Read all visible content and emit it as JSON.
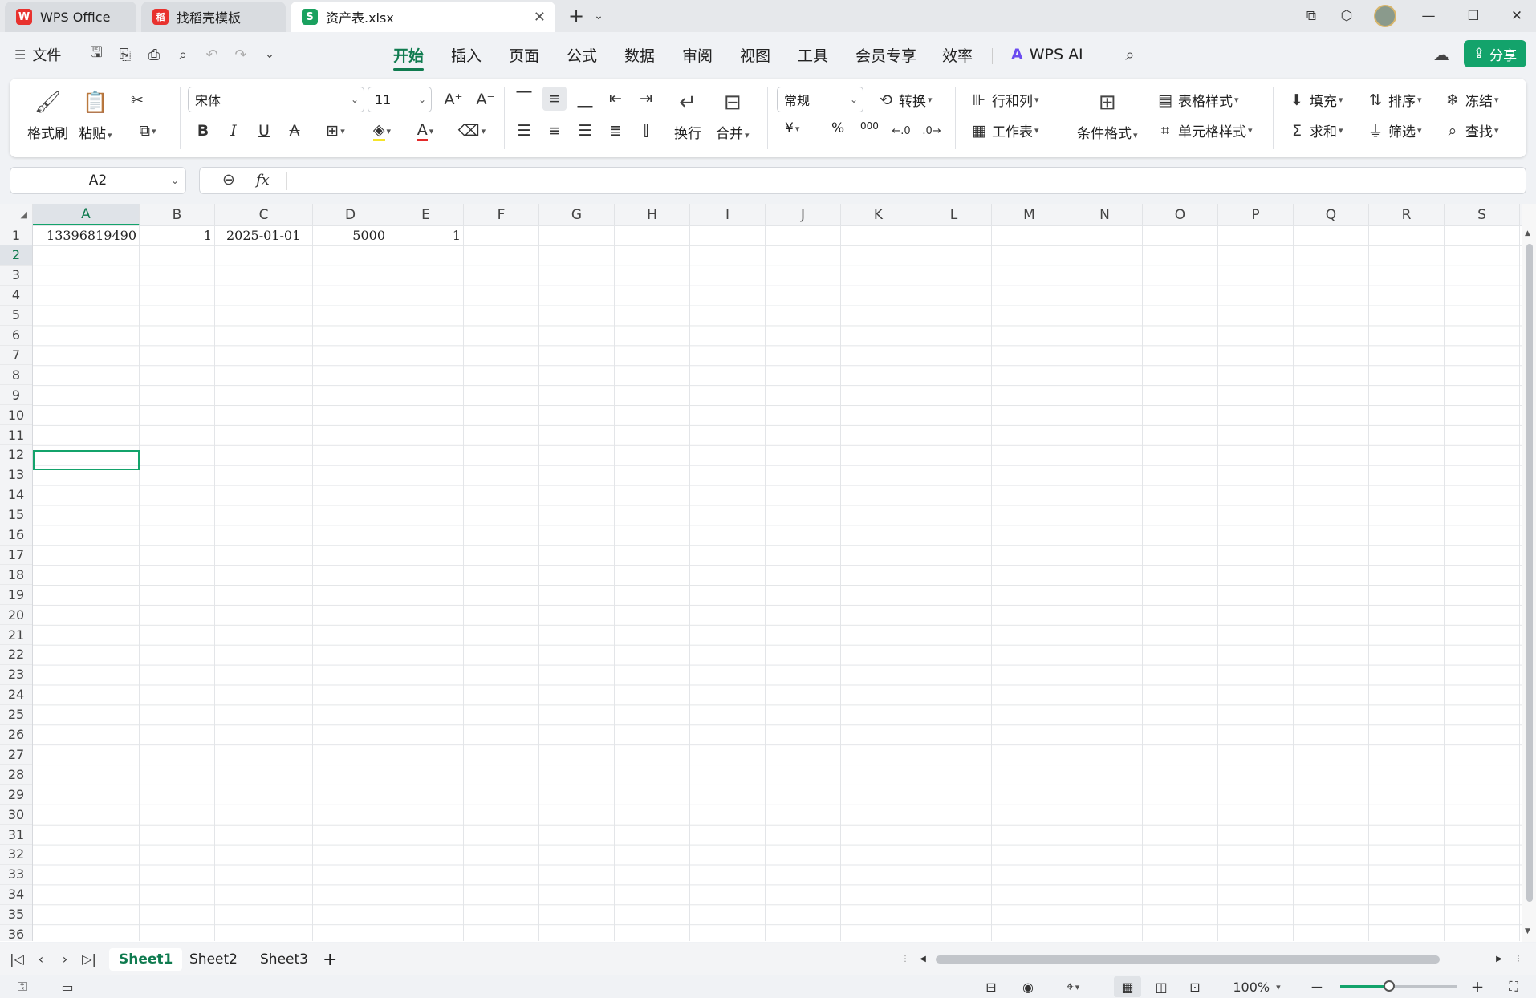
{
  "titlebar": {
    "tabs": [
      {
        "label": "WPS Office",
        "logo": "W"
      },
      {
        "label": "找稻壳模板",
        "logo": "稻"
      },
      {
        "label": "资产表.xlsx",
        "logo": "S"
      }
    ],
    "new_tab": "+",
    "tab_menu": "⌄"
  },
  "menu": {
    "file_label": "文件",
    "tabs": [
      "开始",
      "插入",
      "页面",
      "公式",
      "数据",
      "审阅",
      "视图",
      "工具",
      "会员专享",
      "效率"
    ],
    "active_tab": "开始",
    "ai_label": "WPS AI",
    "share_label": "分享"
  },
  "ribbon": {
    "format_painter": "格式刷",
    "paste": "粘贴",
    "font_name": "宋体",
    "font_size": "11",
    "wrap": "换行",
    "merge": "合并",
    "number_format": "常规",
    "convert": "转换",
    "rows_cols": "行和列",
    "worksheet": "工作表",
    "conditional_format": "条件格式",
    "table_style": "表格样式",
    "cell_style": "单元格样式",
    "fill": "填充",
    "sort": "排序",
    "freeze": "冻结",
    "sum": "求和",
    "filter": "筛选",
    "find": "查找",
    "bold": "B",
    "italic": "I",
    "underline": "U",
    "strike": "A",
    "font_color_glyph": "A",
    "currency": "¥",
    "percent": "%",
    "thousands": "000"
  },
  "formula_bar": {
    "name_box": "A2",
    "fx": "fx",
    "content": ""
  },
  "sheet": {
    "columns": [
      "A",
      "B",
      "C",
      "D",
      "E",
      "F",
      "G",
      "H",
      "I",
      "J",
      "K",
      "L",
      "M",
      "N",
      "O",
      "P",
      "Q",
      "R",
      "S"
    ],
    "row_numbers": [
      "1",
      "2",
      "3",
      "4",
      "5",
      "6",
      "7",
      "8",
      "9",
      "10",
      "11",
      "12",
      "13",
      "14",
      "15",
      "16",
      "17",
      "18",
      "19",
      "20",
      "21",
      "22",
      "23",
      "24",
      "25",
      "26",
      "27",
      "28",
      "29",
      "30",
      "31",
      "32",
      "33",
      "34",
      "35",
      "36"
    ],
    "selected_cell": "A2",
    "row1": {
      "A": "13396819490",
      "B": "1",
      "C": "2025-01-01",
      "D": "5000",
      "E": "1"
    }
  },
  "sheet_tabs": {
    "tabs": [
      "Sheet1",
      "Sheet2",
      "Sheet3"
    ],
    "active": "Sheet1",
    "add": "+"
  },
  "status": {
    "zoom": "100%",
    "zoom_fraction": 0.42
  },
  "colors": {
    "accent": "#13a36b",
    "accent_dark": "#0f7b4f",
    "wps_red": "#e8322e",
    "sheet_green": "#1aa15f"
  }
}
